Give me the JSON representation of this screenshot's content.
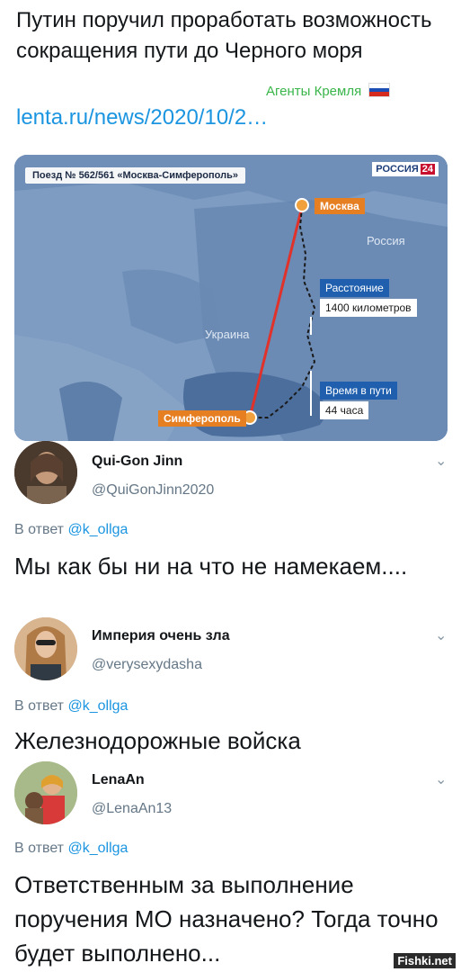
{
  "post": {
    "headline": "Путин поручил проработать возможность сокращения пути до Черного моря",
    "source_tag": "Агенты Кремля",
    "link": "lenta.ru/news/2020/10/2…"
  },
  "map_card": {
    "train": "Поезд № 562/561 «Москва-Симферополь»",
    "channel": "РОССИЯ",
    "channel_num": "24",
    "moscow": "Москва",
    "russia": "Россия",
    "ukraine": "Украина",
    "simferopol": "Симферополь",
    "distance_label": "Расстояние",
    "distance_value": "1400 километров",
    "time_label": "Время в пути",
    "time_value": "44 часа"
  },
  "replies": [
    {
      "name": "Qui-Gon Jinn",
      "handle": "@QuiGonJinn2020",
      "reply_prefix": "В ответ",
      "reply_to": "@k_ollga",
      "text": "Мы как бы ни на что не намекаем...."
    },
    {
      "name": "Империя очень зла",
      "handle": "@verysexydasha",
      "reply_prefix": "В ответ",
      "reply_to": "@k_ollga",
      "text": "Железнодорожные войска"
    },
    {
      "name": "LenaAn",
      "handle": "@LenaAn13",
      "reply_prefix": "В ответ",
      "reply_to": "@k_ollga",
      "text": "Ответственным за выполнение поручения МО назначено? Тогда точно будет выполнено..."
    }
  ],
  "watermark": "Fishki.net",
  "icons": {
    "chevron": "chevron-down-icon",
    "flag": "russia-flag-icon"
  },
  "colors": {
    "link": "#1b95e0",
    "secondary": "#657786",
    "source_tag": "#3ab54a"
  }
}
